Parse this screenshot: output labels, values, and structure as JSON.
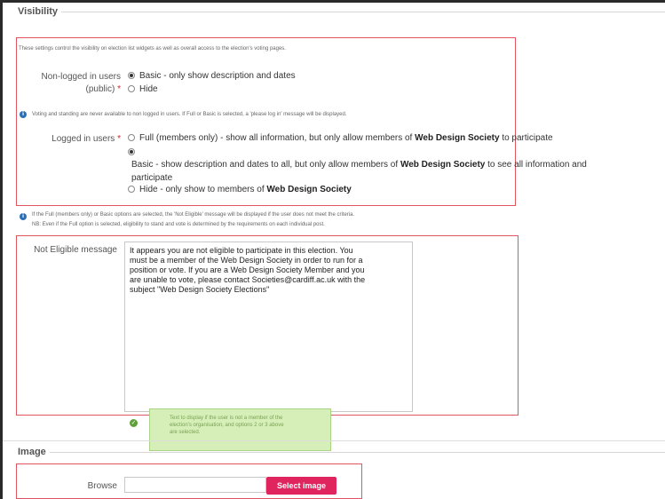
{
  "visibility": {
    "legend": "Visibility",
    "intro": "These settings control the visibility on election list widgets as well as overall access to the election's voting pages.",
    "non_logged": {
      "label_line1": "Non-logged in users",
      "label_line2": "(public)",
      "required_mark": "*",
      "options": [
        {
          "label": "Basic - only show description and dates",
          "checked": true
        },
        {
          "label": "Hide",
          "checked": false
        }
      ]
    },
    "info_note": "Voting and standing are never available to non logged in users. If Full or Basic is selected, a 'please log in' message will be displayed.",
    "logged_in": {
      "label": "Logged in users",
      "required_mark": "*",
      "opt_full_pre": "Full (members only) - show all information, but only allow members of",
      "opt_full_org": "Web Design Society",
      "opt_full_post": "to participate",
      "opt_basic_pre": "Basic - show description and dates to all, but only allow members of",
      "opt_basic_org": "Web Design Society",
      "opt_basic_post": "to see all information and",
      "opt_basic_line2": "participate",
      "opt_hide_pre": "Hide - only show to members of",
      "opt_hide_org": "Web Design Society",
      "checked_index": 1
    },
    "criteria_note_line1": "If the Full (members only) or Basic options are selected, the 'Not Eligible' message will be displayed if the user does not meet the criteria.",
    "criteria_note_line2": "NB: Even if the Full option is selected, eligibility to stand and vote is determined by the requirements on each individual post."
  },
  "not_eligible": {
    "label": "Not Eligible message",
    "value_lines": [
      "It appears you are not eligible to participate in this election.  You",
      "must be a member of the Web Design Society in order to run for a",
      "position or vote.  If you are a Web Design Society Member and you",
      "are unable to vote, please contact Societies@cardiff.ac.uk with the",
      "subject \"Web Design Society Elections\""
    ],
    "hint_lines": [
      "Text to display if the user is not a member of the",
      "election's organisation, and options 2 or 3 above",
      "are selected."
    ]
  },
  "image": {
    "legend": "Image",
    "browse_label": "Browse",
    "select_button": "Select image"
  },
  "colors": {
    "highlight_border": "#e0555f",
    "accent_button": "#e0245e",
    "hint_bg": "#d6efb8",
    "info_blue": "#2b6fb6"
  }
}
